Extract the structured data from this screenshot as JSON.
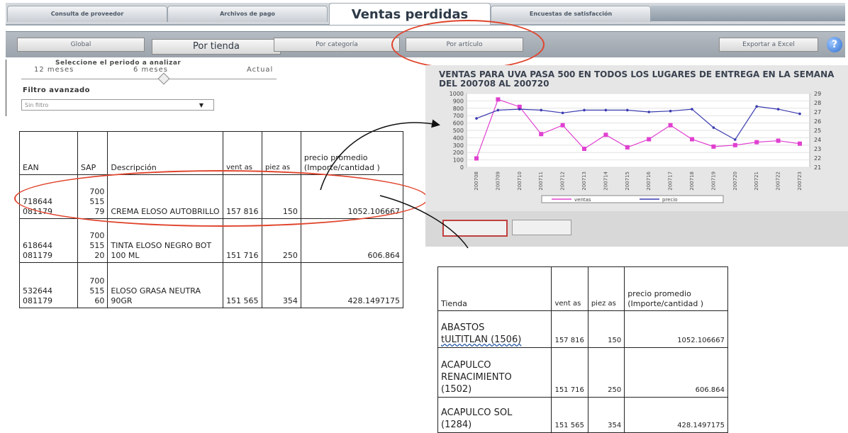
{
  "tabs": [
    {
      "label": "Consulta de proveedor"
    },
    {
      "label": "Archivos de pago"
    },
    {
      "label": "Ventas perdidas"
    },
    {
      "label": "Encuestas de satisfacción"
    }
  ],
  "subnav": {
    "global": "Global",
    "por_tienda": "Por tienda",
    "por_categoria": "Por categoría",
    "por_articulo": "Por artículo",
    "export": "Exportar a Excel",
    "help": "?"
  },
  "period": {
    "title": "Seleccione el periodo a analizar",
    "options": [
      "12 meses",
      "6 meses",
      "Actual"
    ]
  },
  "filter": {
    "title": "Filtro avanzado",
    "value": "Sin filtro"
  },
  "products_table": {
    "headers": {
      "ean": "EAN",
      "sap": "SAP",
      "desc": "Descripción",
      "ventas": "vent as",
      "piezas": "piez as",
      "precio": "precio promedio (Importe/cantidad )"
    },
    "rows": [
      {
        "ean": "718644 081179",
        "sap": "700 515 79",
        "desc": "CREMA ELOSO AUTOBRILLO",
        "ventas": "157 816",
        "piezas": "150",
        "precio": "1052.106667"
      },
      {
        "ean": "618644 081179",
        "sap": "700 515 20",
        "desc": "TINTA ELOSO NEGRO BOT 100 ML",
        "ventas": "151 716",
        "piezas": "250",
        "precio": "606.864"
      },
      {
        "ean": "532644 081179",
        "sap": "700 515 60",
        "desc": "ELOSO GRASA NEUTRA 90GR",
        "ventas": "151 565",
        "piezas": "354",
        "precio": "428.1497175"
      }
    ]
  },
  "stores_table": {
    "headers": {
      "tienda": "Tienda",
      "ventas": "vent as",
      "piezas": "piez as",
      "precio": "precio promedio (Importe/cantidad )"
    },
    "rows": [
      {
        "tienda_a": "ABASTOS",
        "tienda_b": "tULTITLAN (1506)",
        "ventas": "157 816",
        "piezas": "150",
        "precio": "1052.106667"
      },
      {
        "tienda_a": "ACAPULCO RENACIMIENTO",
        "tienda_b": "(1502)",
        "ventas": "151 716",
        "piezas": "250",
        "precio": "606.864"
      },
      {
        "tienda_a": "ACAPULCO SOL",
        "tienda_b": "(1284)",
        "ventas": "151 565",
        "piezas": "354",
        "precio": "428.1497175"
      }
    ]
  },
  "chart_title": "VENTAS PARA UVA PASA 500 EN TODOS LOS LUGARES DE ENTREGA EN LA SEMANA DEL 200708 AL 200720",
  "chart_data": {
    "type": "line",
    "title": "VENTAS PARA UVA PASA 500 EN TODOS LOS LUGARES DE ENTREGA EN LA SEMANA DEL 200708 AL 200720",
    "categories": [
      "200708",
      "200709",
      "200710",
      "200711",
      "200712",
      "200713",
      "200714",
      "200715",
      "200716",
      "200717",
      "200718",
      "200719",
      "200720",
      "200721",
      "200722",
      "200723"
    ],
    "ylim_left": [
      0,
      1000
    ],
    "yticks_left": [
      0,
      100,
      200,
      300,
      400,
      500,
      600,
      700,
      800,
      900,
      1000
    ],
    "ylim_right": [
      21,
      29
    ],
    "yticks_right": [
      21,
      22,
      23,
      24,
      25,
      26,
      27,
      28,
      29
    ],
    "series": [
      {
        "name": "ventas",
        "axis": "left",
        "color": "#e040d0",
        "values": [
          120,
          920,
          820,
          450,
          570,
          250,
          440,
          270,
          380,
          570,
          380,
          280,
          300,
          340,
          360,
          320
        ]
      },
      {
        "name": "precio",
        "axis": "right",
        "color": "#3a3ab0",
        "values": [
          26.3,
          27.2,
          27.3,
          27.2,
          26.9,
          27.2,
          27.2,
          27.2,
          27,
          27.1,
          27.3,
          25.3,
          24,
          27.6,
          27.3,
          26.8
        ]
      }
    ],
    "legend": "bottom",
    "grid": true
  }
}
